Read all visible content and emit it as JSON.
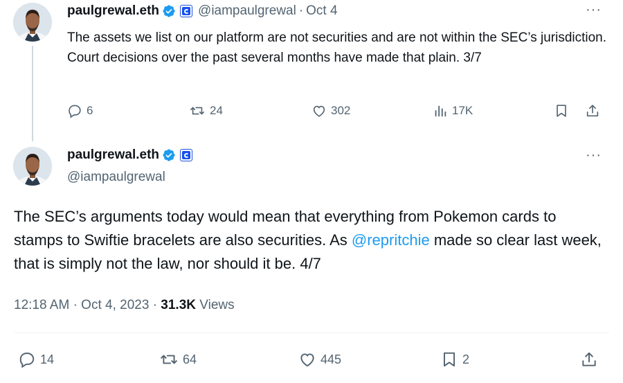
{
  "tweet1": {
    "display_name": "paulgrewal.eth",
    "handle": "@iampaulgrewal",
    "separator": "·",
    "date": "Oct 4",
    "more": "···",
    "text": "The assets we list on our platform are not securities and are not within the SEC’s jurisdiction. Court decisions over the past several months have made that plain. 3/7",
    "actions": {
      "replies": "6",
      "reposts": "24",
      "likes": "302",
      "views": "17K"
    }
  },
  "tweet2": {
    "display_name": "paulgrewal.eth",
    "handle": "@iampaulgrewal",
    "more": "···",
    "text_before": "The SEC’s arguments today would mean that everything from Pokemon cards to stamps to Swiftie bracelets are also securities. As ",
    "mention": "@repritchie",
    "text_after": " made so clear last week, that is simply not the law, nor should it be. 4/7",
    "time": "12:18 AM",
    "separator": "·",
    "date": "Oct 4, 2023",
    "views_count": "31.3K",
    "views_label": "Views",
    "actions": {
      "replies": "14",
      "reposts": "64",
      "likes": "445",
      "bookmarks": "2"
    }
  },
  "colors": {
    "accent": "#1d9bf0",
    "muted": "#536471",
    "text": "#0f1419",
    "affiliate": "#1652f0"
  },
  "icons": [
    "reply-icon",
    "repost-icon",
    "like-icon",
    "views-icon",
    "bookmark-icon",
    "share-icon",
    "verified-badge-icon",
    "affiliate-badge-icon",
    "more-icon"
  ]
}
